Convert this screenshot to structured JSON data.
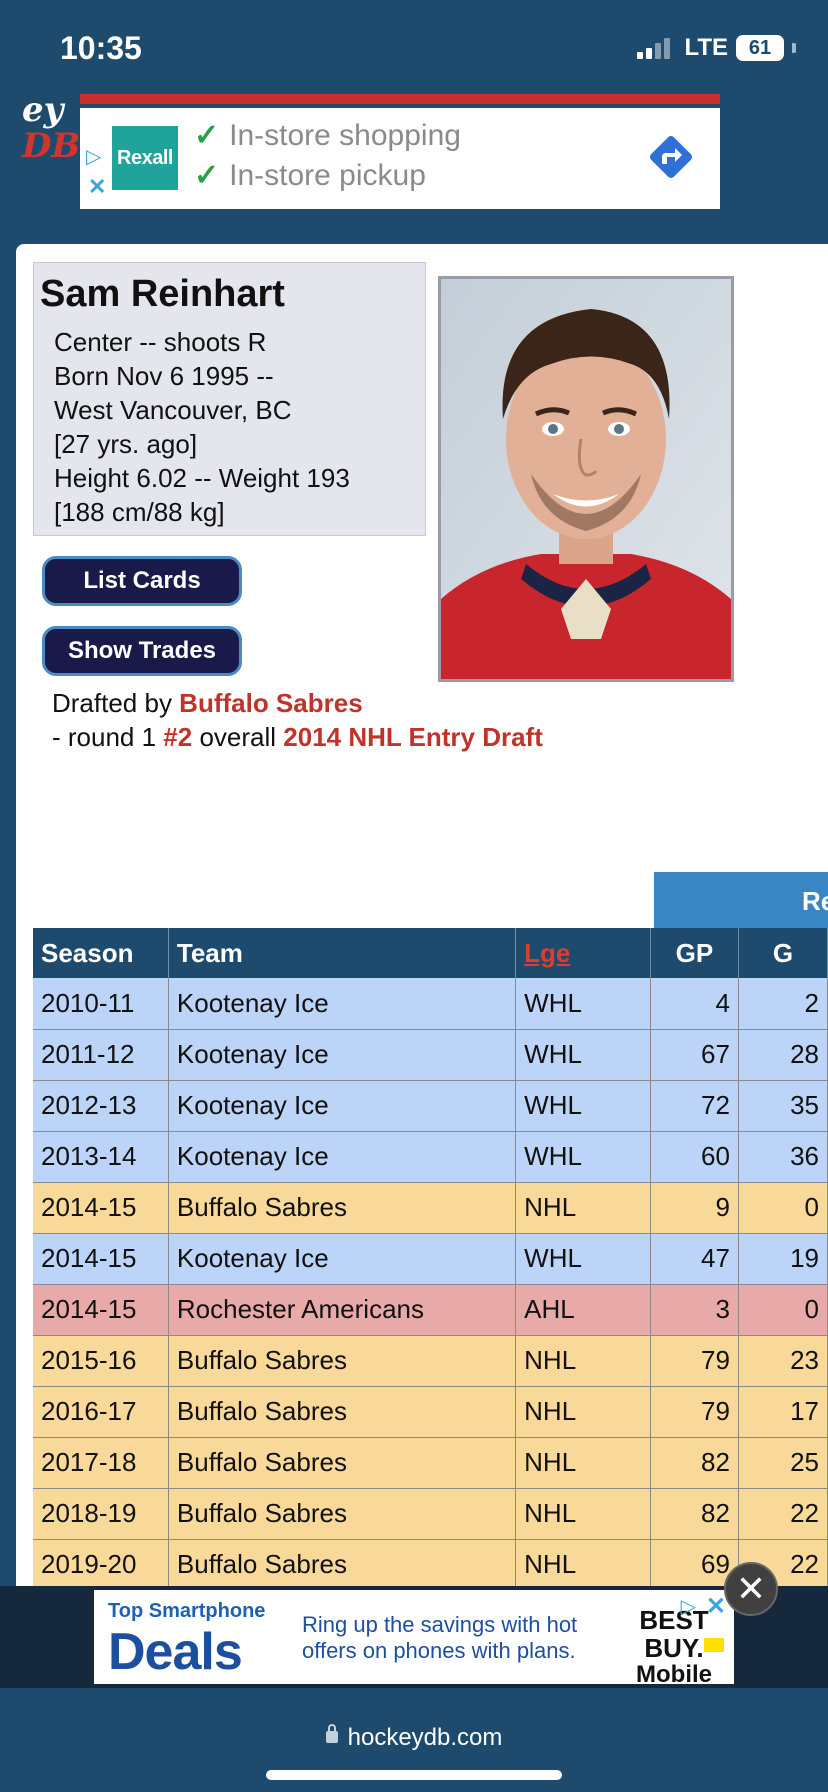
{
  "status_bar": {
    "time": "10:35",
    "network": "LTE",
    "battery": "61"
  },
  "site_logo": {
    "top": "ey",
    "bottom": "DB"
  },
  "ad_top": {
    "brand": "Rexall",
    "line1": "In-store shopping",
    "line2": "In-store pickup"
  },
  "player": {
    "name": "Sam Reinhart",
    "bio": [
      "Center -- shoots R",
      "Born Nov 6 1995 --",
      "West Vancouver, BC",
      "[27 yrs. ago]",
      "Height 6.02 -- Weight 193",
      "[188 cm/88 kg]"
    ]
  },
  "buttons": {
    "list_cards": "List Cards",
    "show_trades": "Show Trades"
  },
  "draft": {
    "prefix": "Drafted by ",
    "team": "Buffalo Sabres",
    "line2_prefix": "- round 1 ",
    "pick": "#2",
    "mid": " overall ",
    "draft_name": "2014 NHL Entry Draft"
  },
  "stats": {
    "group_header": "Re",
    "headers": {
      "season": "Season",
      "team": "Team",
      "lge": "Lge",
      "gp": "GP",
      "g": "G"
    },
    "rows": [
      {
        "season": "2010-11",
        "team": "Kootenay Ice",
        "lge": "WHL",
        "gp": "4",
        "g": "2"
      },
      {
        "season": "2011-12",
        "team": "Kootenay Ice",
        "lge": "WHL",
        "gp": "67",
        "g": "28"
      },
      {
        "season": "2012-13",
        "team": "Kootenay Ice",
        "lge": "WHL",
        "gp": "72",
        "g": "35"
      },
      {
        "season": "2013-14",
        "team": "Kootenay Ice",
        "lge": "WHL",
        "gp": "60",
        "g": "36"
      },
      {
        "season": "2014-15",
        "team": "Buffalo Sabres",
        "lge": "NHL",
        "gp": "9",
        "g": "0"
      },
      {
        "season": "2014-15",
        "team": "Kootenay Ice",
        "lge": "WHL",
        "gp": "47",
        "g": "19"
      },
      {
        "season": "2014-15",
        "team": "Rochester Americans",
        "lge": "AHL",
        "gp": "3",
        "g": "0"
      },
      {
        "season": "2015-16",
        "team": "Buffalo Sabres",
        "lge": "NHL",
        "gp": "79",
        "g": "23"
      },
      {
        "season": "2016-17",
        "team": "Buffalo Sabres",
        "lge": "NHL",
        "gp": "79",
        "g": "17"
      },
      {
        "season": "2017-18",
        "team": "Buffalo Sabres",
        "lge": "NHL",
        "gp": "82",
        "g": "25"
      },
      {
        "season": "2018-19",
        "team": "Buffalo Sabres",
        "lge": "NHL",
        "gp": "82",
        "g": "22"
      },
      {
        "season": "2019-20",
        "team": "Buffalo Sabres",
        "lge": "NHL",
        "gp": "69",
        "g": "22"
      }
    ]
  },
  "ad_bottom": {
    "small": "Top Smartphone",
    "big": "Deals",
    "text1": "Ring up the savings with hot",
    "text2": "offers on phones with plans.",
    "logo_line1": "BEST",
    "logo_line2": "BUY.",
    "logo_line3": "Mobile"
  },
  "browser": {
    "url": "hockeydb.com"
  },
  "colors": {
    "whl": "#bcd4f7",
    "nhl": "#f8d99a",
    "ahl": "#e8aaa8",
    "header": "#1e4a6e",
    "accent_red": "#c0332a"
  }
}
